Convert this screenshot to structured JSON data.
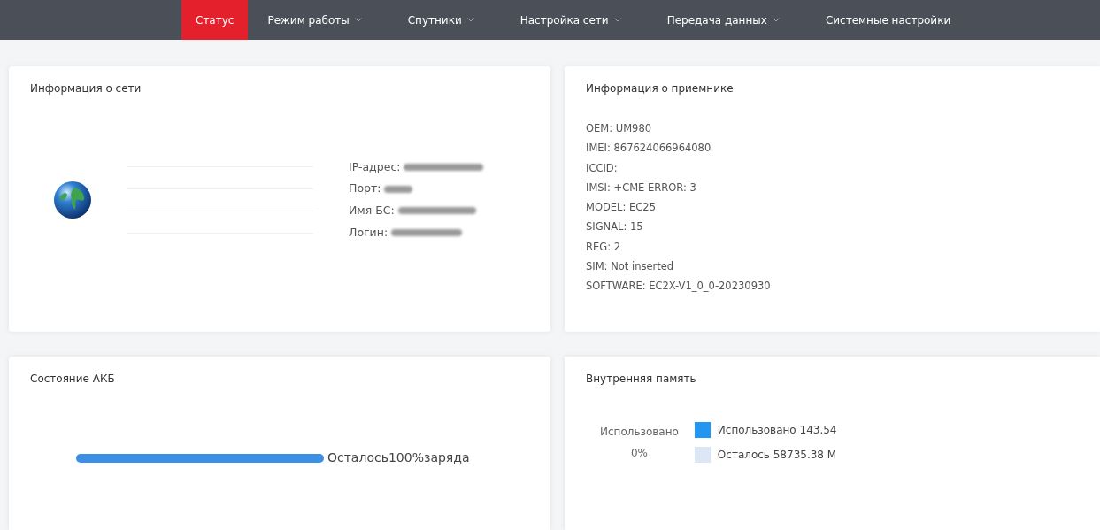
{
  "nav": [
    {
      "label": "Статус",
      "selected": true,
      "dropdown": false
    },
    {
      "label": "Режим работы",
      "selected": false,
      "dropdown": true
    },
    {
      "label": "Спутники",
      "selected": false,
      "dropdown": true
    },
    {
      "label": "Настройка сети",
      "selected": false,
      "dropdown": true
    },
    {
      "label": "Передача данных",
      "selected": false,
      "dropdown": true
    },
    {
      "label": "Системные настройки",
      "selected": false,
      "dropdown": false
    }
  ],
  "network_card": {
    "title": "Информация о сети",
    "fields": [
      {
        "label": "IP-адрес:",
        "redacted": true
      },
      {
        "label": "Порт:",
        "redacted": true
      },
      {
        "label": "Имя БС:",
        "redacted": true
      },
      {
        "label": "Логин:",
        "redacted": true
      }
    ]
  },
  "receiver_card": {
    "title": "Информация о приемнике",
    "lines": [
      "OEM: UM980",
      "IMEI: 867624066964080",
      "ICCID:",
      "IMSI: +CME ERROR: 3",
      "MODEL: EC25",
      "SIGNAL: 15",
      "REG: 2",
      "SIM: Not inserted",
      "SOFTWARE: EC2X-V1_0_0-20230930"
    ]
  },
  "battery_card": {
    "title": "Состояние АКБ",
    "level": 1,
    "reading": "Осталось100%заряда"
  },
  "memory_card": {
    "title": "Внутренняя память",
    "center_label": "Использовано",
    "center_value": "0%",
    "legend": [
      {
        "label": "Использовано 143.54",
        "color": "#2196f3"
      },
      {
        "label": "Осталось 58735.38 M",
        "color": "#dbe7f5"
      }
    ]
  }
}
